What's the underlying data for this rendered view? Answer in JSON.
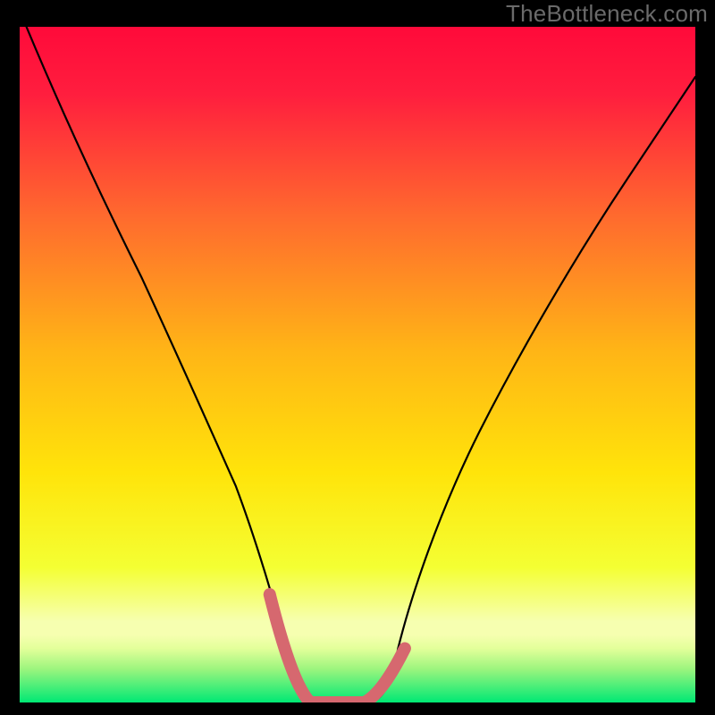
{
  "watermark": "TheBottleneck.com",
  "chart_data": {
    "type": "line",
    "title": "",
    "xlabel": "",
    "ylabel": "",
    "xlim": [
      0,
      100
    ],
    "ylim": [
      0,
      100
    ],
    "background_gradient": {
      "top_rgb": "#ff0a3a",
      "mid_rgb": "#ffd500",
      "bottom_rgb": "#00e874",
      "bottom_band_top_rgb": "#f6ffb0"
    },
    "series": [
      {
        "name": "bottleneck-curve",
        "stroke": "#000000",
        "stroke_width": 2,
        "x": [
          1,
          6,
          12,
          18,
          24,
          28,
          32,
          35,
          38,
          40,
          42,
          44,
          48,
          52,
          54,
          56,
          58,
          62,
          68,
          76,
          86,
          100
        ],
        "y": [
          100,
          88,
          75,
          63,
          50,
          41,
          32,
          24,
          14,
          6,
          1,
          0,
          0,
          0,
          1,
          4,
          8,
          16,
          28,
          42,
          58,
          78
        ]
      },
      {
        "name": "minimum-highlight",
        "stroke": "#d6686f",
        "stroke_width": 12,
        "x": [
          37,
          39,
          41,
          43,
          45,
          48,
          51,
          53,
          55,
          57
        ],
        "y": [
          16,
          8,
          2,
          0,
          0,
          0,
          0,
          1,
          4,
          8
        ]
      }
    ],
    "annotations": []
  }
}
